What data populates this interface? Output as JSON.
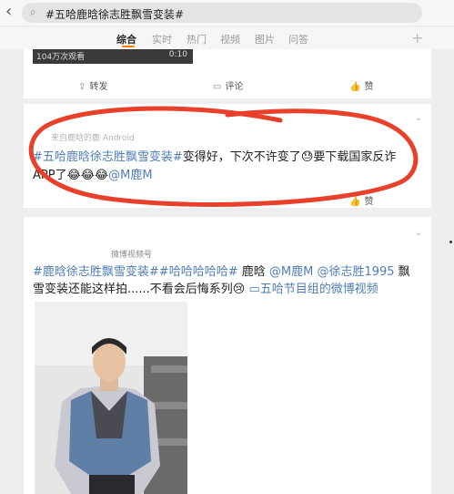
{
  "search": {
    "query": "#五哈鹿晗徐志胜飘雪变装#"
  },
  "tabs": [
    "综合",
    "实时",
    "热门",
    "视频",
    "图片",
    "问答"
  ],
  "post1": {
    "views": "104万次观看",
    "duration": "0:10",
    "repost_label": "转发",
    "comment_label": "评论",
    "like_label": "赞"
  },
  "post2": {
    "meta": "来自鹿晗的鹿 Android",
    "topic": "#五哈鹿晗徐志胜飘雪变装#",
    "text1": "变得好，下次不许变了",
    "emoji1": "😓",
    "text2": "要下载国家反诈APP了",
    "emojis": "😂😂😂",
    "mention": "@M鹿M",
    "like_label": "赞"
  },
  "post3": {
    "source": "微博视频号",
    "topic1": "#鹿晗徐志胜飘雪变装#",
    "topic2": "#哈哈哈哈哈#",
    "text_a": " 鹿晗 ",
    "mention1": "@M鹿M",
    "mention2": "@徐志胜1995",
    "text_b": " 飘雪变装还能这样拍......不看会后悔系列",
    "emoji": "😢",
    "link": "▭五哈节目组的微博视频"
  }
}
